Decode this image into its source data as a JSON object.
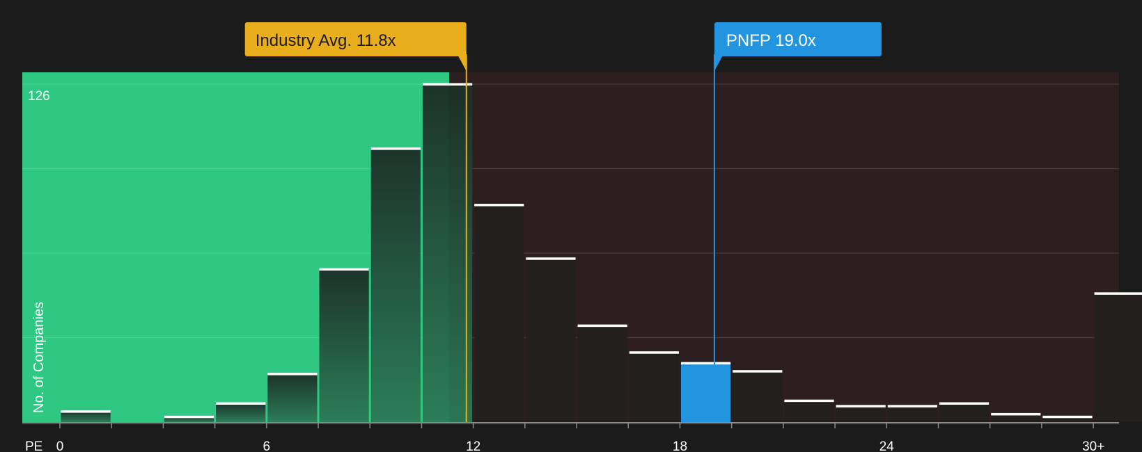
{
  "chart_data": {
    "type": "bar",
    "x_axis_label": "PE",
    "y_axis_label": "No. of Companies",
    "y_max_label": "126",
    "ylim": [
      0,
      126
    ],
    "xlim": [
      0,
      30
    ],
    "x_ticks": [
      "0",
      "6",
      "12",
      "18",
      "24",
      "30+"
    ],
    "x_tick_values": [
      0,
      6,
      12,
      18,
      24,
      30
    ],
    "bins": [
      {
        "x0": 0.0,
        "x1": 1.5,
        "value": 4
      },
      {
        "x0": 1.5,
        "x1": 3.0,
        "value": 0
      },
      {
        "x0": 3.0,
        "x1": 4.5,
        "value": 2
      },
      {
        "x0": 4.5,
        "x1": 6.0,
        "value": 7
      },
      {
        "x0": 6.0,
        "x1": 7.5,
        "value": 18
      },
      {
        "x0": 7.5,
        "x1": 9.0,
        "value": 57
      },
      {
        "x0": 9.0,
        "x1": 10.5,
        "value": 102
      },
      {
        "x0": 10.5,
        "x1": 12.0,
        "value": 126
      },
      {
        "x0": 12.0,
        "x1": 13.5,
        "value": 81
      },
      {
        "x0": 13.5,
        "x1": 15.0,
        "value": 61
      },
      {
        "x0": 15.0,
        "x1": 16.5,
        "value": 36
      },
      {
        "x0": 16.5,
        "x1": 18.0,
        "value": 26
      },
      {
        "x0": 18.0,
        "x1": 19.5,
        "value": 22
      },
      {
        "x0": 19.5,
        "x1": 21.0,
        "value": 19
      },
      {
        "x0": 21.0,
        "x1": 22.5,
        "value": 8
      },
      {
        "x0": 22.5,
        "x1": 24.0,
        "value": 6
      },
      {
        "x0": 24.0,
        "x1": 25.5,
        "value": 6
      },
      {
        "x0": 25.5,
        "x1": 27.0,
        "value": 7
      },
      {
        "x0": 27.0,
        "x1": 28.5,
        "value": 3
      },
      {
        "x0": 28.5,
        "x1": 30.0,
        "value": 2
      },
      {
        "x0": 30.0,
        "x1": 31.5,
        "value": 48
      }
    ],
    "industry_avg": {
      "label": "Industry Avg. 11.8x",
      "value": 11.8
    },
    "company": {
      "label": "PNFP 19.0x",
      "value": 19.0,
      "bin_index": 12
    },
    "colors": {
      "background": "#1b1b1b",
      "below_region": "#2ec882",
      "above_region": "#2d1e1f",
      "bar_dark": "#231f1f",
      "bar_highlight": "#2394e0",
      "industry": "#e9ae1c",
      "company": "#2394e0",
      "cap": "#ffffff",
      "grid": "#ffffff",
      "axis": "#8a8a8a"
    }
  }
}
